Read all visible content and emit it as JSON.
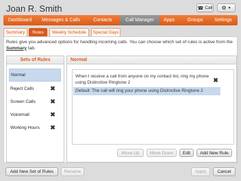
{
  "header": {
    "user_name": "Joan R. Smith",
    "call_label": "Call"
  },
  "nav": {
    "tabs": [
      {
        "label": "Dashboard",
        "active": false
      },
      {
        "label": "Messages & Calls",
        "active": false
      },
      {
        "label": "Contacts",
        "active": false
      },
      {
        "label": "Call Manager",
        "active": true
      },
      {
        "label": "Apps",
        "active": false
      },
      {
        "label": "Groups",
        "active": false
      },
      {
        "label": "Settings",
        "active": false
      }
    ]
  },
  "subtabs": [
    {
      "label": "Summary",
      "active": false
    },
    {
      "label": "Rules",
      "active": true
    },
    {
      "label": "Weekly Schedule",
      "active": false
    },
    {
      "label": "Special Days",
      "active": false
    }
  ],
  "description": {
    "text": "Rules give you advanced options for handling incoming calls. You can choose which set of rules is active from the ",
    "link": "Summary",
    "suffix": " tab."
  },
  "rule_sets": {
    "heading": "Sets of Rules",
    "items": [
      "Normal",
      "Reject Calls",
      "Screen Calls",
      "Voicemail",
      "Working Hours"
    ],
    "selected": "Normal"
  },
  "rules_panel": {
    "heading": "Normal",
    "rule_text": "When I receive a call from anyone on my contact list, ring my phone using Distinctive Ringtone 2",
    "default_label": "Default:",
    "default_text": " The call will ring your phone using Distinctive Ringtone 2",
    "buttons": {
      "move_up": "Move Up",
      "move_down": "Move Down",
      "edit": "Edit",
      "add_rule": "Add New Rule"
    }
  },
  "footer": {
    "add_set": "Add New Set of Rules",
    "rename": "Rename",
    "apply": "Apply",
    "cancel": "Cancel"
  },
  "colors": {
    "accent": "#d9581a",
    "nav_bar": "#e66a28",
    "active_nav": "#8a8a8a",
    "selection": "#c8d9ee"
  }
}
